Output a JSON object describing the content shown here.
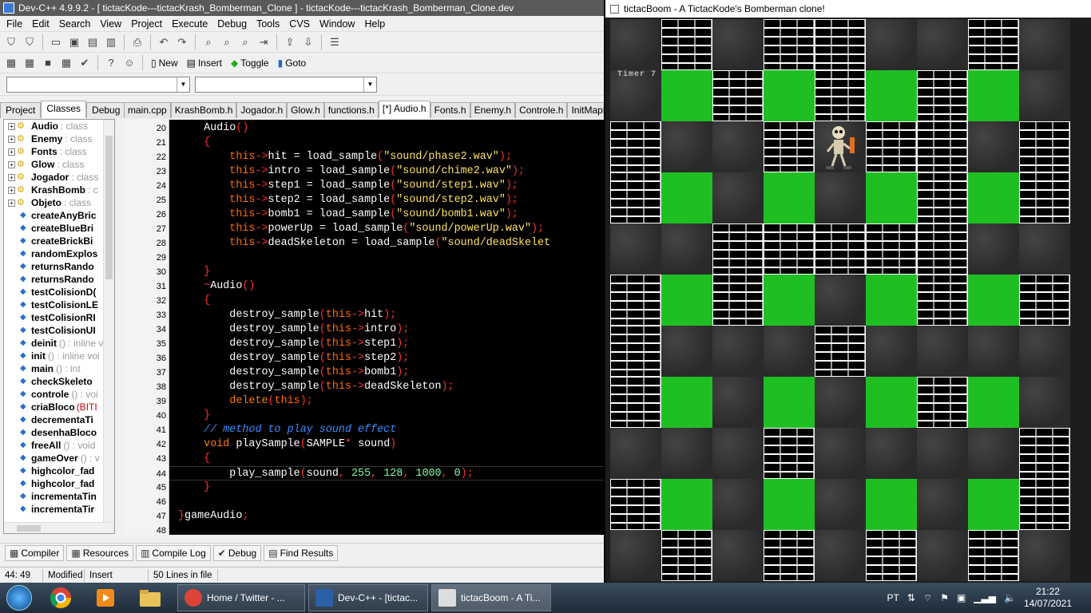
{
  "ide": {
    "title": "Dev-C++ 4.9.9.2  - [ tictacKode---tictacKrash_Bomberman_Clone ] - tictacKode---tictacKrash_Bomberman_Clone.dev",
    "menu": [
      "File",
      "Edit",
      "Search",
      "View",
      "Project",
      "Execute",
      "Debug",
      "Tools",
      "CVS",
      "Window",
      "Help"
    ],
    "toolbar2": {
      "new": "New",
      "insert": "Insert",
      "toggle": "Toggle",
      "goto": "Goto"
    },
    "left_tabs": [
      "Project",
      "Classes",
      "Debug"
    ],
    "editor_tabs": [
      "main.cpp",
      "KrashBomb.h",
      "Jogador.h",
      "Glow.h",
      "functions.h",
      "[*] Audio.h",
      "Fonts.h",
      "Enemy.h",
      "Controle.h",
      "InitMapMatrix.h"
    ],
    "class_tree": [
      {
        "name": "Audio",
        "kind": ": class",
        "type": "class"
      },
      {
        "name": "Enemy",
        "kind": ": class",
        "type": "class"
      },
      {
        "name": "Fonts",
        "kind": ": class",
        "type": "class"
      },
      {
        "name": "Glow",
        "kind": ": class",
        "type": "class"
      },
      {
        "name": "Jogador",
        "kind": ": class",
        "type": "class"
      },
      {
        "name": "KrashBomb",
        "kind": ": c",
        "type": "class"
      },
      {
        "name": "Objeto",
        "kind": ": class",
        "type": "class"
      },
      {
        "name": "createAnyBric",
        "kind": "",
        "type": "fn"
      },
      {
        "name": "createBlueBri",
        "kind": "",
        "type": "fn"
      },
      {
        "name": "createBrickBi",
        "kind": "",
        "type": "fn"
      },
      {
        "name": "randomExplos",
        "kind": "",
        "type": "fn"
      },
      {
        "name": "returnsRando",
        "kind": "",
        "type": "fn"
      },
      {
        "name": "returnsRando",
        "kind": "",
        "type": "fn"
      },
      {
        "name": "testColisionD(",
        "kind": "",
        "type": "fn"
      },
      {
        "name": "testColisionLE",
        "kind": "",
        "type": "fn"
      },
      {
        "name": "testColisionRI",
        "kind": "",
        "type": "fn"
      },
      {
        "name": "testColisionUI",
        "kind": "",
        "type": "fn"
      },
      {
        "name": "deinit",
        "kind": "() : inline v",
        "type": "fn"
      },
      {
        "name": "init",
        "kind": "() : inline voi",
        "type": "fn"
      },
      {
        "name": "main",
        "kind": "() : int",
        "type": "fn"
      },
      {
        "name": "checkSkeleto",
        "kind": "",
        "type": "fn"
      },
      {
        "name": "controle",
        "kind": "() : voi",
        "type": "fn"
      },
      {
        "name": "criaBloco",
        "kind": "(BITI",
        "type": "fnred"
      },
      {
        "name": "decrementaTi",
        "kind": "",
        "type": "fn"
      },
      {
        "name": "desenhaBloco",
        "kind": "",
        "type": "fn"
      },
      {
        "name": "freeAll",
        "kind": "() : void",
        "type": "fn"
      },
      {
        "name": "gameOver",
        "kind": "() : v",
        "type": "fn"
      },
      {
        "name": "highcolor_fad",
        "kind": "",
        "type": "fn"
      },
      {
        "name": "highcolor_fad",
        "kind": "",
        "type": "fn"
      },
      {
        "name": "incrementaTin",
        "kind": "",
        "type": "fn"
      },
      {
        "name": "incrementaTir",
        "kind": "",
        "type": "fn"
      }
    ],
    "code_lines": [
      {
        "n": "20",
        "html": "    Audio<span class=\"p\">()</span>"
      },
      {
        "n": "21",
        "html": "    <span class=\"p\">{</span>"
      },
      {
        "n": "22",
        "html": "        <span class=\"t\">this</span><span class=\"p\">-&gt;</span>hit = load_sample<span class=\"p\">(</span><span class=\"s\">\"sound/phase2.wav\"</span><span class=\"p\">);</span>"
      },
      {
        "n": "23",
        "html": "        <span class=\"t\">this</span><span class=\"p\">-&gt;</span>intro = load_sample<span class=\"p\">(</span><span class=\"s\">\"sound/chime2.wav\"</span><span class=\"p\">);</span>"
      },
      {
        "n": "24",
        "html": "        <span class=\"t\">this</span><span class=\"p\">-&gt;</span>step1 = load_sample<span class=\"p\">(</span><span class=\"s\">\"sound/step1.wav\"</span><span class=\"p\">);</span>"
      },
      {
        "n": "25",
        "html": "        <span class=\"t\">this</span><span class=\"p\">-&gt;</span>step2 = load_sample<span class=\"p\">(</span><span class=\"s\">\"sound/step2.wav\"</span><span class=\"p\">);</span>"
      },
      {
        "n": "26",
        "html": "        <span class=\"t\">this</span><span class=\"p\">-&gt;</span>bomb1 = load_sample<span class=\"p\">(</span><span class=\"s\">\"sound/bomb1.wav\"</span><span class=\"p\">);</span>"
      },
      {
        "n": "27",
        "html": "        <span class=\"t\">this</span><span class=\"p\">-&gt;</span>powerUp = load_sample<span class=\"p\">(</span><span class=\"s\">\"sound/powerUp.wav\"</span><span class=\"p\">);</span>"
      },
      {
        "n": "28",
        "html": "        <span class=\"t\">this</span><span class=\"p\">-&gt;</span>deadSkeleton = load_sample<span class=\"p\">(</span><span class=\"s\">\"sound/deadSkelet</span>"
      },
      {
        "n": "29",
        "html": ""
      },
      {
        "n": "30",
        "html": "    <span class=\"p\">}</span>"
      },
      {
        "n": "31",
        "html": "    <span class=\"p\">~</span>Audio<span class=\"p\">()</span>"
      },
      {
        "n": "32",
        "html": "    <span class=\"p\">{</span>"
      },
      {
        "n": "33",
        "html": "        destroy_sample<span class=\"p\">(</span><span class=\"t\">this</span><span class=\"p\">-&gt;</span>hit<span class=\"p\">);</span>"
      },
      {
        "n": "34",
        "html": "        destroy_sample<span class=\"p\">(</span><span class=\"t\">this</span><span class=\"p\">-&gt;</span>intro<span class=\"p\">);</span>"
      },
      {
        "n": "35",
        "html": "        destroy_sample<span class=\"p\">(</span><span class=\"t\">this</span><span class=\"p\">-&gt;</span>step1<span class=\"p\">);</span>"
      },
      {
        "n": "36",
        "html": "        destroy_sample<span class=\"p\">(</span><span class=\"t\">this</span><span class=\"p\">-&gt;</span>step2<span class=\"p\">);</span>"
      },
      {
        "n": "37",
        "html": "        destroy_sample<span class=\"p\">(</span><span class=\"t\">this</span><span class=\"p\">-&gt;</span>bomb1<span class=\"p\">);</span>"
      },
      {
        "n": "38",
        "html": "        destroy_sample<span class=\"p\">(</span><span class=\"t\">this</span><span class=\"p\">-&gt;</span>deadSkeleton<span class=\"p\">);</span>"
      },
      {
        "n": "39",
        "html": "        <span class=\"k\">delete</span><span class=\"p\">(</span><span class=\"t\">this</span><span class=\"p\">);</span>"
      },
      {
        "n": "40",
        "html": "    <span class=\"p\">}</span>"
      },
      {
        "n": "41",
        "html": "    <span class=\"c\">// method to play sound effect</span>"
      },
      {
        "n": "42",
        "html": "    <span class=\"k\">void</span> playSample<span class=\"p\">(</span>SAMPLE<span class=\"p\">*</span> sound<span class=\"p\">)</span>"
      },
      {
        "n": "43",
        "html": "    <span class=\"p\">{</span>"
      },
      {
        "n": "44",
        "html": "        play_sample<span class=\"p\">(</span>sound<span class=\"p\">,</span> <span class=\"n\">255</span><span class=\"p\">,</span> <span class=\"n\">128</span><span class=\"p\">,</span> <span class=\"n\">1000</span><span class=\"p\">,</span> <span class=\"n\">0</span><span class=\"p\">);</span>"
      },
      {
        "n": "45",
        "html": "    <span class=\"p\">}</span>"
      },
      {
        "n": "46",
        "html": ""
      },
      {
        "n": "47",
        "html": "<span class=\"p\">}</span>gameAudio<span class=\"p\">;</span>"
      },
      {
        "n": "48",
        "html": ""
      }
    ],
    "bottom_tabs": [
      "Compiler",
      "Resources",
      "Compile Log",
      "Debug",
      "Find Results"
    ],
    "status": {
      "pos": "44: 49",
      "modified": "Modified",
      "mode": "Insert",
      "lines": "50 Lines in file"
    }
  },
  "game": {
    "title": "tictacBoom - A TictacKode's Bomberman clone!",
    "timer_label": "Timer 7",
    "grid": [
      "SBSBBSSBS",
      "SGBGBGBGS",
      "BSSBPBBSB",
      "BGSGSGBGB",
      "SSBBBBBSS",
      "BGBGSGBGB",
      "BSSSBSSSS",
      "BGSGSGBGS",
      "SSSBSSSSB",
      "BGSGSGSGB",
      "SBSBSBSBS"
    ]
  },
  "taskbar": {
    "apps": [
      {
        "label": "Home / Twitter - ...",
        "icon": "chrome-icon"
      },
      {
        "label": "Dev-C++ - [tictac...",
        "icon": "devcpp-icon"
      },
      {
        "label": "tictacBoom - A Ti...",
        "icon": "game-window-icon"
      }
    ],
    "lang": "PT",
    "time": "21:22",
    "date": "14/07/2021"
  }
}
